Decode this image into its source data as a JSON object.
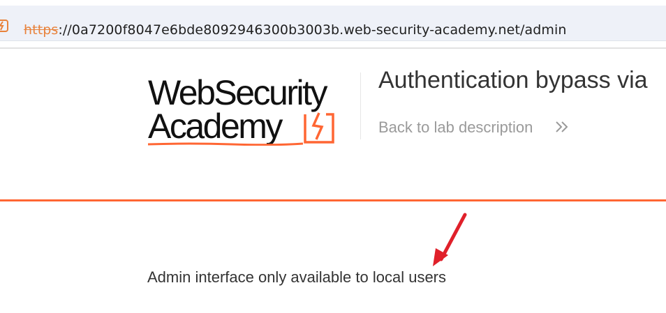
{
  "browser": {
    "url_scheme": "https",
    "url_rest": "://0a7200f8047e6bde8092946300b3003b.web-security-academy.net/admin",
    "site_icon": "lightning-bolt-icon"
  },
  "header": {
    "logo_line1": "WebSecurity",
    "logo_line2": "Academy",
    "logo_mark_icon": "lightning-bolt-icon",
    "lab_title": "Authentication bypass via",
    "back_link": "Back to lab description",
    "back_icon": "double-chevron-right-icon"
  },
  "main": {
    "message": "Admin interface only available to local users"
  },
  "colors": {
    "accent": "#ff6633",
    "annotation": "#e0202a",
    "url_scheme": "#e8823b"
  }
}
